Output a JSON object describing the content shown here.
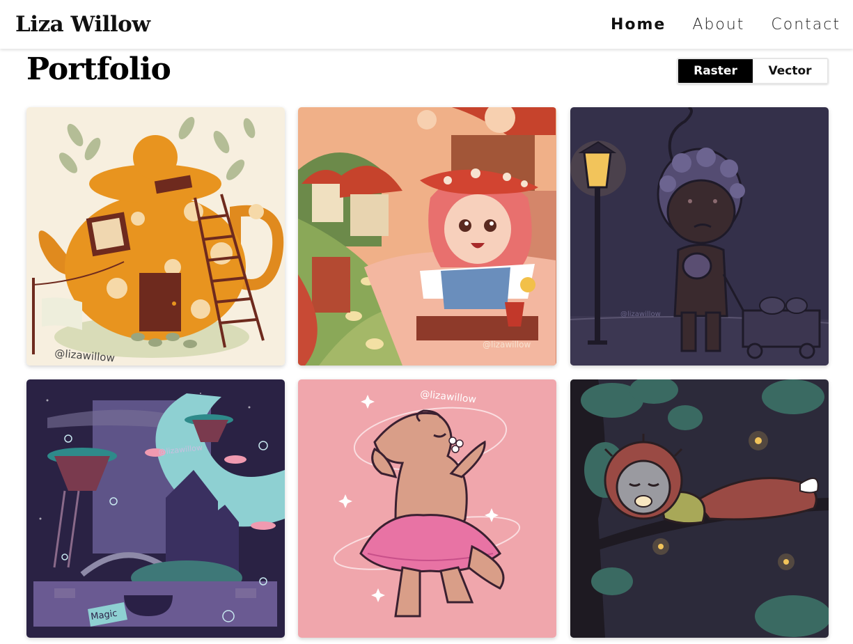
{
  "header": {
    "brand": "Liza Willow",
    "nav": [
      {
        "label": "Home",
        "active": true
      },
      {
        "label": "About",
        "active": false
      },
      {
        "label": "Contact",
        "active": false
      }
    ]
  },
  "main": {
    "title": "Portfolio",
    "toggle": {
      "options": [
        "Raster",
        "Vector"
      ],
      "selected": "Raster"
    },
    "gallery": {
      "watermark": "@lizawillow",
      "tag_text": "Magic",
      "items": [
        {
          "name": "teapot-house-artwork",
          "background": "#f7efdf"
        },
        {
          "name": "mushroom-girl-artwork",
          "background": "#f0b088"
        },
        {
          "name": "lamp-post-kid-artwork",
          "background": "#34304a"
        },
        {
          "name": "magic-suitcase-artwork",
          "background": "#2a2244"
        },
        {
          "name": "tutu-dinosaur-artwork",
          "background": "#f0a6ac"
        },
        {
          "name": "sleeping-critter-artwork",
          "background": "#2c2a3a"
        }
      ]
    }
  },
  "colors": {
    "accent": "#000000",
    "text": "#111111",
    "card_shadow": "rgba(0,0,0,0.18)"
  }
}
